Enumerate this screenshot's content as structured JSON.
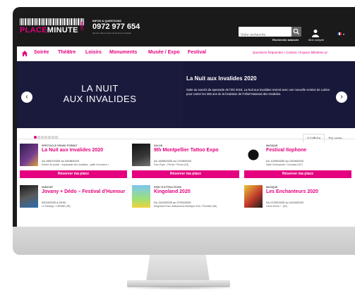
{
  "site": {
    "logo_prefix": "PLACE",
    "logo_suffix": "MINUTE",
    "logo_com": ".COM",
    "info_label": "INFOS & QUESTIONS",
    "phone": "0972 977 654",
    "info_sub": "Service client ouvert du lundi au vendredi",
    "search_placeholder": "Votre recherche",
    "advanced_search": "Recherche avancée",
    "account_label": "Mon compte",
    "brand_color": "#e4007e"
  },
  "nav": {
    "items": [
      "Soirée",
      "Théâtre",
      "Loisirs",
      "Monuments",
      "Musée / Expo",
      "Festival"
    ],
    "right": "Questions fréquentes • Contact • Espace billetterie pr"
  },
  "hero": {
    "image_line1": "LA NUIT",
    "image_line2": "AUX INVALIDES",
    "heading": "La Nuit aux Invalides 2020",
    "description": "Suite au succès du spectacle de l'été 2019, La Nuit aux Invalides revient avec une nouvelle version de Lutèce pour conter les 350 ans de la fondation de l'Hôtel National des Invalides.",
    "prev": "‹",
    "next": "›"
  },
  "tabs": [
    "À l'affiche",
    "Top vente"
  ],
  "cards": [
    {
      "category": "SPECTACLE GRAND FORMAT",
      "title": "La Nuit aux Invalides 2020",
      "date": "Du 08/07/2020 au 29/08/2020",
      "place": "Entrée du public : esplanade des Invalides - grille d'honneur /...",
      "button": "Réserver ma place"
    },
    {
      "category": "SALON",
      "title": "9th Montpellier Tattoo Expo",
      "date": "Du 16/05/2020 au 17/05/2020",
      "place": "Parc Expo - Pérols / Pérols (34)",
      "button": "Réserver ma place"
    },
    {
      "category": "MUSIQUE",
      "title": "Festival Ilophone",
      "date": "Du 12/09/2020 au 13/09/2020",
      "place": "Salle Omnisports / Coussard (97)",
      "button": "Réserver ma place"
    },
    {
      "category": "HUMOUR",
      "title": "Jovany + Dédo – Festival d'Humour",
      "date": "03/10/2020 à 20:00",
      "place": "Le Manège / VIENNE (38)",
      "button": ""
    },
    {
      "category": "PARC D'ATTRACTIONS",
      "title": "Kingoland 2020",
      "date": "Du 11/04/2020 au 27/09/2020",
      "place": "Kingoland Parc d'attractions Bretagne Sud / Plumelin (56)",
      "button": ""
    },
    {
      "category": "MUSIQUE",
      "title": "Les Enchanteurs 2020",
      "date": "Du 07/02/2020 au 10/04/2020",
      "place": "Lieux divers / - (62)",
      "button": ""
    }
  ]
}
